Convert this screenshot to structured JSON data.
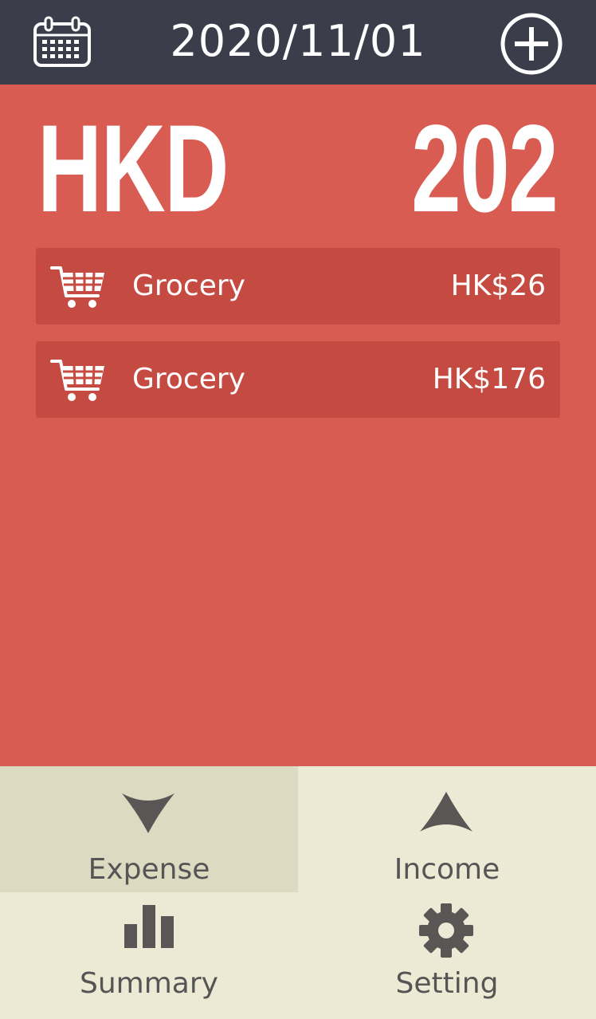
{
  "header": {
    "date": "2020/11/01",
    "calendar_icon": "calendar-icon",
    "add_icon": "plus-circle-icon"
  },
  "summary": {
    "currency": "HKD",
    "total": "202"
  },
  "entries": [
    {
      "category": "Grocery",
      "amount": "HK$26",
      "icon": "shopping-cart-icon"
    },
    {
      "category": "Grocery",
      "amount": "HK$176",
      "icon": "shopping-cart-icon"
    }
  ],
  "nav": {
    "expense": "Expense",
    "income": "Income",
    "summary": "Summary",
    "setting": "Setting"
  },
  "colors": {
    "header_bg": "#3b3d4a",
    "main_bg": "#d85c51",
    "entry_bg": "#c54b42",
    "nav_bg": "#ece9d5",
    "nav_active_bg": "#dcdac1",
    "nav_icon": "#5a5656"
  }
}
